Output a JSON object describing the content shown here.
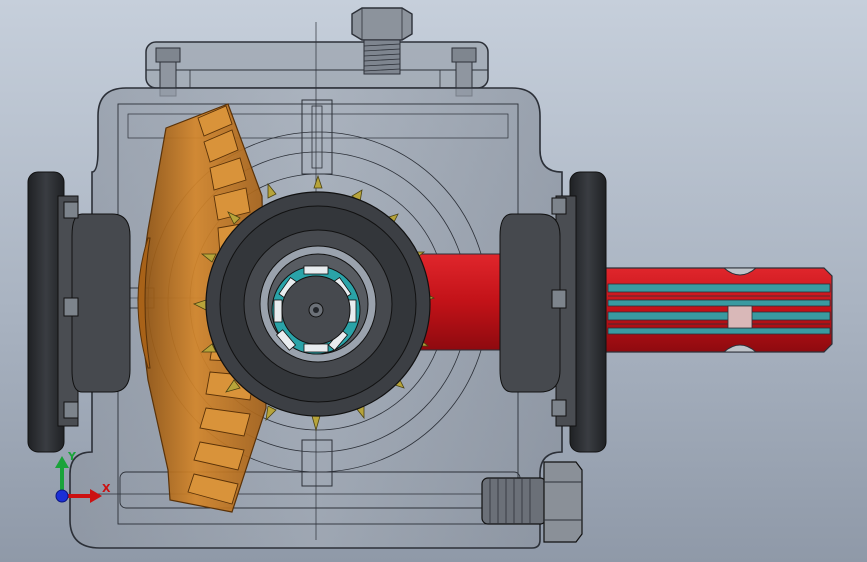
{
  "viewport": {
    "background_top": "#c6cfdb",
    "background_bottom": "#8f99a8",
    "view": "gearbox-transparent-front-view"
  },
  "colors": {
    "housing": "#9aa2ad",
    "housing_edge": "#2c3038",
    "bevel_gear": "#c2741e",
    "bevel_gear_dark": "#8a4f10",
    "pinion": "#3c3f44",
    "pinion_teeth": "#b7a43a",
    "shaft": "#c21218",
    "shaft_groove": "#3a9aa0",
    "bearing_dark": "#2d2f33",
    "bearing_ring_teal": "#2aa3a8"
  },
  "triad": {
    "x_label": "X",
    "y_label": "Y",
    "x_icon": "x-axis-arrow-icon",
    "y_icon": "y-axis-arrow-icon",
    "z_icon": "z-axis-dot-icon"
  }
}
